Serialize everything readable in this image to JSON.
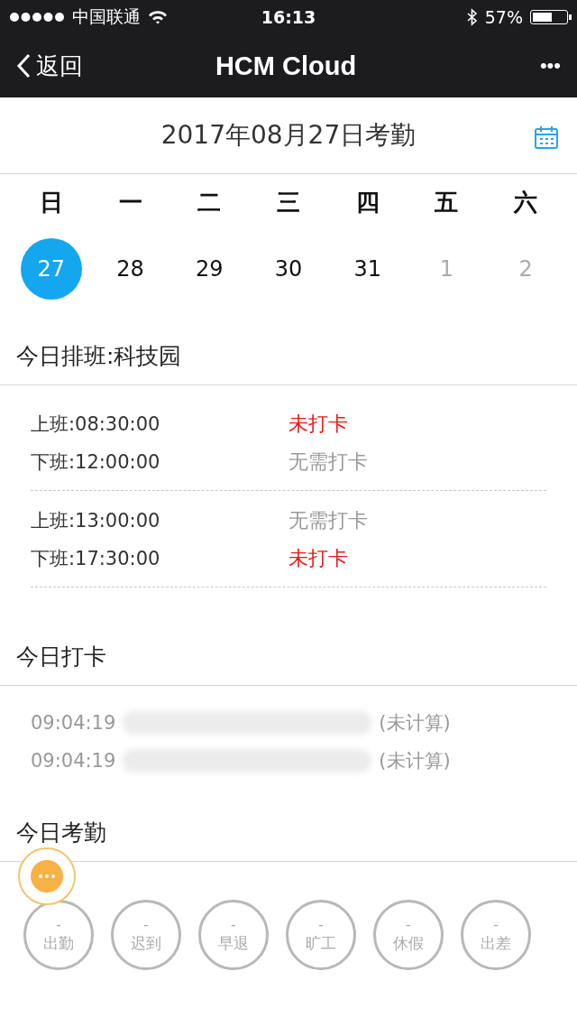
{
  "status_bar": {
    "carrier": "中国联通",
    "time": "16:13",
    "battery_text": "57%"
  },
  "nav": {
    "back": "返回",
    "title": "HCM Cloud",
    "more": "•••"
  },
  "header": {
    "title": "2017年08月27日考勤"
  },
  "week": {
    "weekdays": [
      "日",
      "一",
      "二",
      "三",
      "四",
      "五",
      "六"
    ],
    "days": [
      {
        "label": "27",
        "selected": true,
        "muted": false
      },
      {
        "label": "28",
        "selected": false,
        "muted": false
      },
      {
        "label": "29",
        "selected": false,
        "muted": false
      },
      {
        "label": "30",
        "selected": false,
        "muted": false
      },
      {
        "label": "31",
        "selected": false,
        "muted": false
      },
      {
        "label": "1",
        "selected": false,
        "muted": true
      },
      {
        "label": "2",
        "selected": false,
        "muted": true
      }
    ]
  },
  "schedule": {
    "title": "今日排班:科技园",
    "groups": [
      [
        {
          "time": "上班:08:30:00",
          "status": "未打卡",
          "kind": "missing"
        },
        {
          "time": "下班:12:00:00",
          "status": "无需打卡",
          "kind": "exempt"
        }
      ],
      [
        {
          "time": "上班:13:00:00",
          "status": "无需打卡",
          "kind": "exempt"
        },
        {
          "time": "下班:17:30:00",
          "status": "未打卡",
          "kind": "missing"
        }
      ]
    ]
  },
  "punches": {
    "title": "今日打卡",
    "items": [
      {
        "time": "09:04:19",
        "note": "(未计算)"
      },
      {
        "time": "09:04:19",
        "note": "(未计算)"
      }
    ]
  },
  "attendance": {
    "title": "今日考勤",
    "stats": [
      {
        "value": "-",
        "label": "出勤"
      },
      {
        "value": "-",
        "label": "迟到"
      },
      {
        "value": "-",
        "label": "早退"
      },
      {
        "value": "-",
        "label": "旷工"
      },
      {
        "value": "-",
        "label": "休假"
      },
      {
        "value": "-",
        "label": "出差"
      }
    ]
  }
}
